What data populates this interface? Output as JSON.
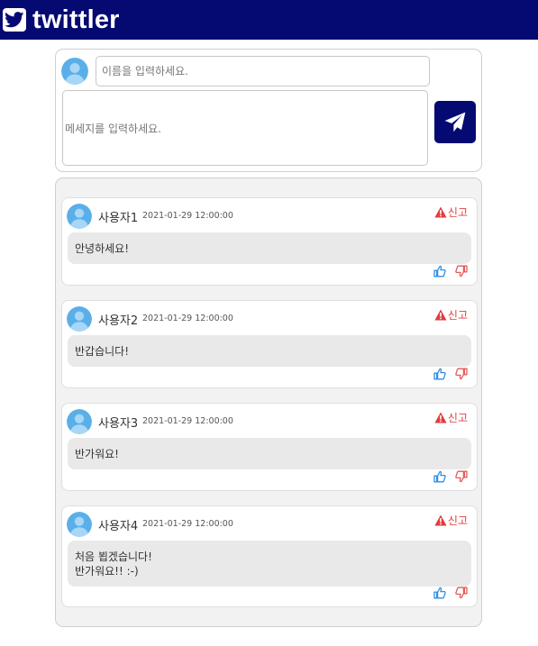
{
  "app": {
    "title": "twittler"
  },
  "compose": {
    "name_placeholder": "이름을 입력하세요.",
    "message_placeholder": "메세지를 입력하세요."
  },
  "tweets": [
    {
      "username": "사용자1",
      "timestamp": "2021-01-29 12:00:00",
      "message": "안녕하세요!"
    },
    {
      "username": "사용자2",
      "timestamp": "2021-01-29 12:00:00",
      "message": "반갑습니다!"
    },
    {
      "username": "사용자3",
      "timestamp": "2021-01-29 12:00:00",
      "message": "반가워요!"
    },
    {
      "username": "사용자4",
      "timestamp": "2021-01-29 12:00:00",
      "message": "처음 뵙겠습니다!\n반가워요!! :-)"
    }
  ],
  "labels": {
    "report": "신고"
  },
  "colors": {
    "header_bg": "#050a72",
    "report": "#e23c3c",
    "like": "#2f8fe0",
    "dislike": "#e35a5a",
    "avatar": "#5aafe8"
  },
  "icons": {
    "logo": "twitter-bird-icon",
    "avatar": "user-avatar-icon",
    "send": "paper-plane-icon",
    "report": "warning-triangle-icon",
    "like": "thumbs-up-icon",
    "dislike": "thumbs-down-icon"
  }
}
